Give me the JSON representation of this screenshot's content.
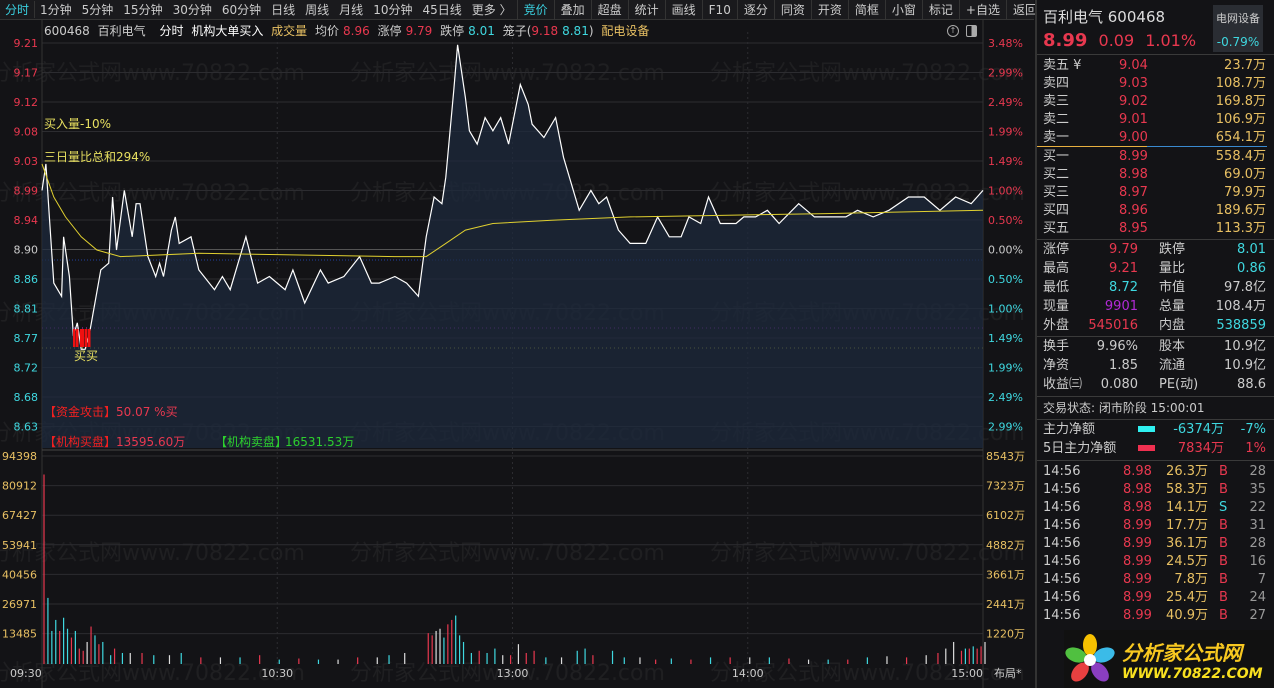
{
  "toolbar": {
    "periods": [
      "分时",
      "1分钟",
      "5分钟",
      "15分钟",
      "30分钟",
      "60分钟",
      "日线",
      "周线",
      "月线",
      "10分钟",
      "45日线",
      "更多 〉"
    ],
    "tools": [
      "竞价",
      "叠加",
      "超盘",
      "统计",
      "画线",
      "F10",
      "逐分",
      "同资",
      "开资",
      "简框",
      "小窗",
      "标记",
      "+自选",
      "返回"
    ]
  },
  "info": {
    "code": "600468",
    "name": "百利电气",
    "mode": "分时",
    "indicator": "机构大单买入",
    "vol_label": "成交量",
    "avg_label": "均价",
    "avg": "8.96",
    "limit_up_label": "涨停",
    "limit_up": "9.79",
    "limit_down_label": "跌停",
    "limit_down": "8.01",
    "cage_label": "笼子(",
    "cage_hi": "9.18",
    "cage_lo": "8.81",
    ")": ")",
    "sector": "配电设备"
  },
  "overlay": {
    "buy_vol": "买入量-10%",
    "three_day": "三日量比总和294%",
    "buy_marker": "买买",
    "attack_label": "【资金攻击】",
    "attack_val": "50.07 %买",
    "inst_buy_label": "【机构买盘】",
    "inst_buy_val": "13595.60万",
    "inst_sell_label": "【机构卖盘】",
    "inst_sell_val": "16531.53万",
    "watermark": "分析家公式网www.70822.com",
    "layout_btn": "布局*"
  },
  "chart_data": {
    "type": "line",
    "title": "百利电气 600468 分时",
    "prev_close": 8.9,
    "ylim": [
      8.6,
      9.24
    ],
    "price_ticks": [
      "9.21",
      "9.17",
      "9.12",
      "9.08",
      "9.03",
      "8.99",
      "8.94",
      "8.90",
      "8.86",
      "8.81",
      "8.77",
      "8.72",
      "8.68",
      "8.63"
    ],
    "pct_ticks": [
      "3.48%",
      "2.99%",
      "2.49%",
      "1.99%",
      "1.49%",
      "1.00%",
      "0.50%",
      "0.00%",
      "0.50%",
      "1.00%",
      "1.49%",
      "1.99%",
      "2.49%",
      "2.99%"
    ],
    "vol_ticks": [
      "94398",
      "80912",
      "67427",
      "53941",
      "40456",
      "26971",
      "13485"
    ],
    "amt_ticks": [
      "8543万",
      "7323万",
      "6102万",
      "4882万",
      "3661万",
      "2441万",
      "1220万"
    ],
    "time_ticks": [
      {
        "label": "09:30",
        "m": 0
      },
      {
        "label": "10:30",
        "m": 60
      },
      {
        "label": "13:00",
        "m": 120
      },
      {
        "label": "14:00",
        "m": 180
      },
      {
        "label": "15:00",
        "m": 240
      }
    ],
    "price": [
      [
        0,
        8.99
      ],
      [
        1,
        9.03
      ],
      [
        2,
        8.94
      ],
      [
        3,
        8.85
      ],
      [
        5,
        8.83
      ],
      [
        5.5,
        8.92
      ],
      [
        7,
        8.86
      ],
      [
        8,
        8.77
      ],
      [
        9,
        8.79
      ],
      [
        10,
        8.75
      ],
      [
        11,
        8.75
      ],
      [
        12,
        8.77
      ],
      [
        15,
        8.87
      ],
      [
        17,
        8.88
      ],
      [
        18,
        8.98
      ],
      [
        19,
        8.9
      ],
      [
        21,
        8.99
      ],
      [
        23,
        8.92
      ],
      [
        24,
        8.97
      ],
      [
        25,
        8.97
      ],
      [
        27,
        8.89
      ],
      [
        29,
        8.86
      ],
      [
        30,
        8.88
      ],
      [
        31,
        8.86
      ],
      [
        33,
        8.93
      ],
      [
        34,
        8.95
      ],
      [
        35,
        8.91
      ],
      [
        38,
        8.92
      ],
      [
        40,
        8.87
      ],
      [
        44,
        8.84
      ],
      [
        46,
        8.86
      ],
      [
        48,
        8.84
      ],
      [
        52,
        8.92
      ],
      [
        55,
        8.85
      ],
      [
        58,
        8.86
      ],
      [
        62,
        8.84
      ],
      [
        64,
        8.87
      ],
      [
        67,
        8.82
      ],
      [
        71,
        8.87
      ],
      [
        73,
        8.85
      ],
      [
        77,
        8.86
      ],
      [
        81,
        8.89
      ],
      [
        84,
        8.85
      ],
      [
        86,
        8.85
      ],
      [
        90,
        8.86
      ],
      [
        93,
        8.85
      ],
      [
        96,
        8.83
      ],
      [
        98,
        8.92
      ],
      [
        100,
        8.98
      ],
      [
        102,
        8.97
      ],
      [
        103,
        9.01
      ],
      [
        105,
        9.14
      ],
      [
        106,
        9.21
      ],
      [
        108,
        9.13
      ],
      [
        109,
        9.08
      ],
      [
        111,
        9.06
      ],
      [
        113,
        9.1
      ],
      [
        115,
        9.08
      ],
      [
        117,
        9.1
      ],
      [
        119,
        9.06
      ],
      [
        121,
        9.12
      ],
      [
        122,
        9.15
      ],
      [
        124,
        9.12
      ],
      [
        125,
        9.09
      ],
      [
        128,
        9.07
      ],
      [
        131,
        9.1
      ],
      [
        133,
        9.04
      ],
      [
        137,
        8.96
      ],
      [
        140,
        8.99
      ],
      [
        142,
        8.97
      ],
      [
        144,
        8.98
      ],
      [
        147,
        8.93
      ],
      [
        150,
        8.91
      ],
      [
        154,
        8.91
      ],
      [
        157,
        8.95
      ],
      [
        160,
        8.92
      ],
      [
        163,
        8.92
      ],
      [
        165,
        8.95
      ],
      [
        168,
        8.94
      ],
      [
        170,
        8.98
      ],
      [
        173,
        8.94
      ],
      [
        177,
        8.94
      ],
      [
        179,
        8.95
      ],
      [
        182,
        8.95
      ],
      [
        185,
        8.96
      ],
      [
        188,
        8.94
      ],
      [
        193,
        8.97
      ],
      [
        197,
        8.95
      ],
      [
        201,
        8.95
      ],
      [
        205,
        8.95
      ],
      [
        208,
        8.96
      ],
      [
        212,
        8.95
      ],
      [
        216,
        8.96
      ],
      [
        221,
        8.98
      ],
      [
        225,
        8.98
      ],
      [
        229,
        8.96
      ],
      [
        233,
        8.98
      ],
      [
        237,
        8.97
      ],
      [
        240,
        8.99
      ]
    ],
    "avg": [
      [
        0,
        9.03
      ],
      [
        3,
        8.98
      ],
      [
        6,
        8.95
      ],
      [
        10,
        8.92
      ],
      [
        14,
        8.9
      ],
      [
        20,
        8.89
      ],
      [
        40,
        8.895
      ],
      [
        60,
        8.893
      ],
      [
        90,
        8.89
      ],
      [
        98,
        8.89
      ],
      [
        103,
        8.91
      ],
      [
        108,
        8.93
      ],
      [
        115,
        8.94
      ],
      [
        130,
        8.945
      ],
      [
        150,
        8.95
      ],
      [
        200,
        8.955
      ],
      [
        240,
        8.96
      ]
    ],
    "volume_ylim": [
      0,
      94398
    ],
    "volume": [
      [
        0,
        86000,
        "r"
      ],
      [
        1,
        30000,
        "c"
      ],
      [
        2,
        15000,
        "c"
      ],
      [
        3,
        20000,
        "c"
      ],
      [
        4,
        15000,
        "r"
      ],
      [
        5,
        21000,
        "c"
      ],
      [
        6,
        16000,
        "c"
      ],
      [
        7,
        12000,
        "r"
      ],
      [
        8,
        15000,
        "c"
      ],
      [
        9,
        7000,
        "r"
      ],
      [
        10,
        6000,
        "r"
      ],
      [
        11,
        10000,
        "w"
      ],
      [
        12,
        17000,
        "r"
      ],
      [
        13,
        13000,
        "c"
      ],
      [
        14,
        9000,
        "r"
      ],
      [
        15,
        10000,
        "c"
      ],
      [
        17,
        4000,
        "c"
      ],
      [
        18,
        7000,
        "r"
      ],
      [
        20,
        5000,
        "c"
      ],
      [
        22,
        5000,
        "w"
      ],
      [
        25,
        5000,
        "r"
      ],
      [
        28,
        4000,
        "c"
      ],
      [
        32,
        4000,
        "w"
      ],
      [
        35,
        5000,
        "c"
      ],
      [
        40,
        3000,
        "r"
      ],
      [
        45,
        3000,
        "w"
      ],
      [
        50,
        3000,
        "c"
      ],
      [
        55,
        4000,
        "r"
      ],
      [
        60,
        2000,
        "c"
      ],
      [
        65,
        2500,
        "r"
      ],
      [
        70,
        2000,
        "c"
      ],
      [
        75,
        2000,
        "w"
      ],
      [
        80,
        3000,
        "r"
      ],
      [
        85,
        3000,
        "w"
      ],
      [
        88,
        4000,
        "c"
      ],
      [
        92,
        5000,
        "w"
      ],
      [
        98,
        14000,
        "r"
      ],
      [
        99,
        13000,
        "r"
      ],
      [
        100,
        15000,
        "w"
      ],
      [
        101,
        16000,
        "w"
      ],
      [
        102,
        12000,
        "c"
      ],
      [
        103,
        18000,
        "r"
      ],
      [
        104,
        20000,
        "r"
      ],
      [
        105,
        22000,
        "c"
      ],
      [
        106,
        13000,
        "c"
      ],
      [
        107,
        10000,
        "c"
      ],
      [
        109,
        5000,
        "c"
      ],
      [
        111,
        6000,
        "r"
      ],
      [
        113,
        5000,
        "c"
      ],
      [
        115,
        7000,
        "c"
      ],
      [
        117,
        4000,
        "w"
      ],
      [
        119,
        4000,
        "r"
      ],
      [
        121,
        9000,
        "w"
      ],
      [
        123,
        5000,
        "r"
      ],
      [
        125,
        6000,
        "r"
      ],
      [
        128,
        3000,
        "c"
      ],
      [
        132,
        3000,
        "w"
      ],
      [
        136,
        6000,
        "c"
      ],
      [
        138,
        7000,
        "c"
      ],
      [
        140,
        4000,
        "r"
      ],
      [
        145,
        6000,
        "c"
      ],
      [
        148,
        3000,
        "c"
      ],
      [
        152,
        3000,
        "w"
      ],
      [
        156,
        2000,
        "r"
      ],
      [
        160,
        2500,
        "c"
      ],
      [
        165,
        2000,
        "r"
      ],
      [
        170,
        3000,
        "c"
      ],
      [
        175,
        3000,
        "r"
      ],
      [
        180,
        3000,
        "w"
      ],
      [
        185,
        3000,
        "c"
      ],
      [
        190,
        2500,
        "r"
      ],
      [
        195,
        2000,
        "w"
      ],
      [
        200,
        2000,
        "c"
      ],
      [
        205,
        2000,
        "r"
      ],
      [
        210,
        3000,
        "c"
      ],
      [
        215,
        3500,
        "w"
      ],
      [
        220,
        3000,
        "r"
      ],
      [
        225,
        4000,
        "w"
      ],
      [
        228,
        5000,
        "r"
      ],
      [
        230,
        7000,
        "w"
      ],
      [
        232,
        10000,
        "w"
      ],
      [
        234,
        6000,
        "r"
      ],
      [
        235,
        7000,
        "c"
      ],
      [
        236,
        7000,
        "r"
      ],
      [
        237,
        8000,
        "c"
      ],
      [
        238,
        7000,
        "r"
      ],
      [
        239,
        8000,
        "r"
      ],
      [
        240,
        10000,
        "w"
      ]
    ]
  },
  "quote": {
    "name": "百利电气 600468",
    "sector": "电网设备",
    "sector_pct": "-0.79%",
    "price": "8.99",
    "change": "0.09",
    "pct": "1.01%",
    "asks": [
      {
        "label": "卖五 ¥",
        "price": "9.04",
        "vol": "23.7万"
      },
      {
        "label": "卖四",
        "price": "9.03",
        "vol": "108.7万"
      },
      {
        "label": "卖三",
        "price": "9.02",
        "vol": "169.8万"
      },
      {
        "label": "卖二",
        "price": "9.01",
        "vol": "106.9万"
      },
      {
        "label": "卖一",
        "price": "9.00",
        "vol": "654.1万"
      }
    ],
    "bids": [
      {
        "label": "买一",
        "price": "8.99",
        "vol": "558.4万"
      },
      {
        "label": "买二",
        "price": "8.98",
        "vol": "69.0万"
      },
      {
        "label": "买三",
        "price": "8.97",
        "vol": "79.9万"
      },
      {
        "label": "买四",
        "price": "8.96",
        "vol": "189.6万"
      },
      {
        "label": "买五",
        "price": "8.95",
        "vol": "113.3万"
      }
    ],
    "stats": [
      {
        "l1": "涨停",
        "v1": "9.79",
        "c1": "red",
        "l2": "跌停",
        "v2": "8.01",
        "c2": "cyan"
      },
      {
        "l1": "最高",
        "v1": "9.21",
        "c1": "red",
        "l2": "量比",
        "v2": "0.86",
        "c2": "cyan"
      },
      {
        "l1": "最低",
        "v1": "8.72",
        "c1": "cyan",
        "l2": "市值",
        "v2": "97.8亿",
        "c2": "wht"
      },
      {
        "l1": "现量",
        "v1": "9901",
        "c1": "pur",
        "l2": "总量",
        "v2": "108.4万",
        "c2": "wht"
      },
      {
        "l1": "外盘",
        "v1": "545016",
        "c1": "red",
        "l2": "内盘",
        "v2": "538859",
        "c2": "cyan"
      }
    ],
    "stats2": [
      {
        "l1": "换手",
        "v1": "9.96%",
        "l2": "股本",
        "v2": "10.9亿"
      },
      {
        "l1": "净资",
        "v1": "1.85",
        "l2": "流通",
        "v2": "10.9亿"
      },
      {
        "l1": "收益㈢",
        "v1": "0.080",
        "l2": "PE(动)",
        "v2": "88.6"
      }
    ],
    "status": "交易状态: 闭市阶段 15:00:01",
    "flow": [
      {
        "label": "主力净额",
        "val": "-6374万",
        "pct": "-7%",
        "color": "#2ff0f0",
        "cls": "cyan"
      },
      {
        "label": "5日主力净额",
        "val": "7834万",
        "pct": "1%",
        "color": "#f03050",
        "cls": "red"
      }
    ],
    "trades": [
      {
        "t": "14:56",
        "p": "8.98",
        "v": "26.3万",
        "s": "B",
        "n": "28"
      },
      {
        "t": "14:56",
        "p": "8.98",
        "v": "58.3万",
        "s": "B",
        "n": "35"
      },
      {
        "t": "14:56",
        "p": "8.98",
        "v": "14.1万",
        "s": "S",
        "n": "22"
      },
      {
        "t": "14:56",
        "p": "8.99",
        "v": "17.7万",
        "s": "B",
        "n": "31"
      },
      {
        "t": "14:56",
        "p": "8.99",
        "v": "36.1万",
        "s": "B",
        "n": "28"
      },
      {
        "t": "14:56",
        "p": "8.99",
        "v": "24.5万",
        "s": "B",
        "n": "16"
      },
      {
        "t": "14:56",
        "p": "8.99",
        "v": "7.8万",
        "s": "B",
        "n": "7"
      },
      {
        "t": "14:56",
        "p": "8.99",
        "v": "25.4万",
        "s": "B",
        "n": "24"
      },
      {
        "t": "14:56",
        "p": "8.99",
        "v": "40.9万",
        "s": "B",
        "n": "27"
      }
    ],
    "logo": {
      "title": "分析家公式网",
      "url": "WWW.70822.COM"
    }
  }
}
